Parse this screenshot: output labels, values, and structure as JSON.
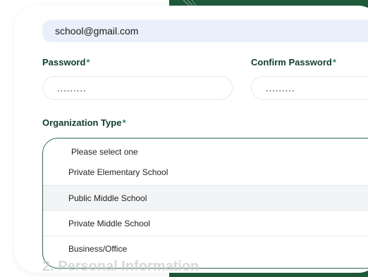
{
  "form": {
    "email_value": "school@gmail.com",
    "password_label": "Password",
    "password_value": ".........",
    "confirm_label": "Confirm Password",
    "confirm_value": ".........",
    "required_marker": "*",
    "org_label": "Organization Type",
    "dropdown": {
      "placeholder": "Please select one",
      "options": [
        "Private Elementary School",
        "Public Middle School",
        "Private Middle School",
        "Business/Office"
      ]
    },
    "next_section": "2. Personal Information"
  },
  "colors": {
    "accent_green": "#1f5a3a",
    "label_green": "#0f3d2a",
    "input_blue": "#eaf0fb"
  }
}
